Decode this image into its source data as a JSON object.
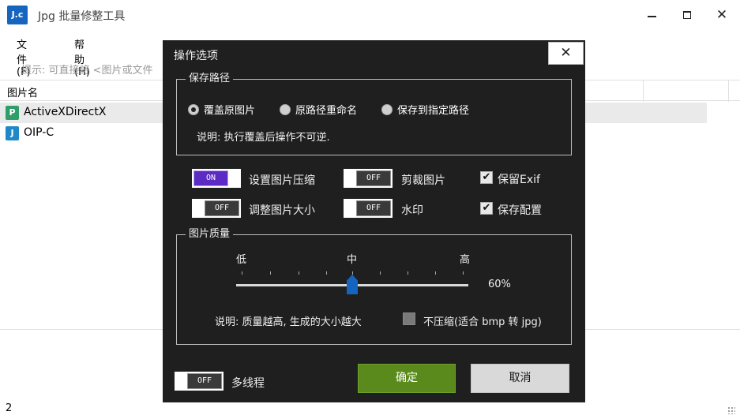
{
  "window": {
    "icon_text": "J.c",
    "title": "Jpg 批量修整工具"
  },
  "menu": {
    "file": "文件(F)",
    "help": "帮助(H)"
  },
  "hint": "提示: 可直接将 <图片或文件",
  "list": {
    "column_name": "图片名",
    "rows": [
      {
        "icon": "P",
        "name": "ActiveXDirectX"
      },
      {
        "icon": "J",
        "name": "OIP-C"
      }
    ]
  },
  "status": {
    "count": "2"
  },
  "dialog": {
    "title": "操作选项",
    "close": "✕",
    "save_path": {
      "title": "保存路径",
      "options": [
        "覆盖原图片",
        "原路径重命名",
        "保存到指定路径"
      ],
      "selected": 0,
      "note": "说明: 执行覆盖后操作不可逆."
    },
    "toggles": {
      "compress": {
        "state": "ON",
        "label": "设置图片压缩"
      },
      "crop": {
        "state": "OFF",
        "label": "剪裁图片"
      },
      "resize": {
        "state": "OFF",
        "label": "调整图片大小"
      },
      "watermark": {
        "state": "OFF",
        "label": "水印"
      },
      "multithread": {
        "state": "OFF",
        "label": "多线程"
      }
    },
    "checkboxes": {
      "keep_exif": {
        "checked": true,
        "label": "保留Exif"
      },
      "save_config": {
        "checked": true,
        "label": "保存配置"
      }
    },
    "quality": {
      "title": "图片质量",
      "low": "低",
      "mid": "中",
      "high": "高",
      "value": 60,
      "value_text": "60%",
      "note": "说明: 质量越高, 生成的大小越大",
      "no_compress_label": "不压缩(适合 bmp 转 jpg)",
      "no_compress_checked": false
    },
    "ok": "确定",
    "cancel": "取消"
  }
}
